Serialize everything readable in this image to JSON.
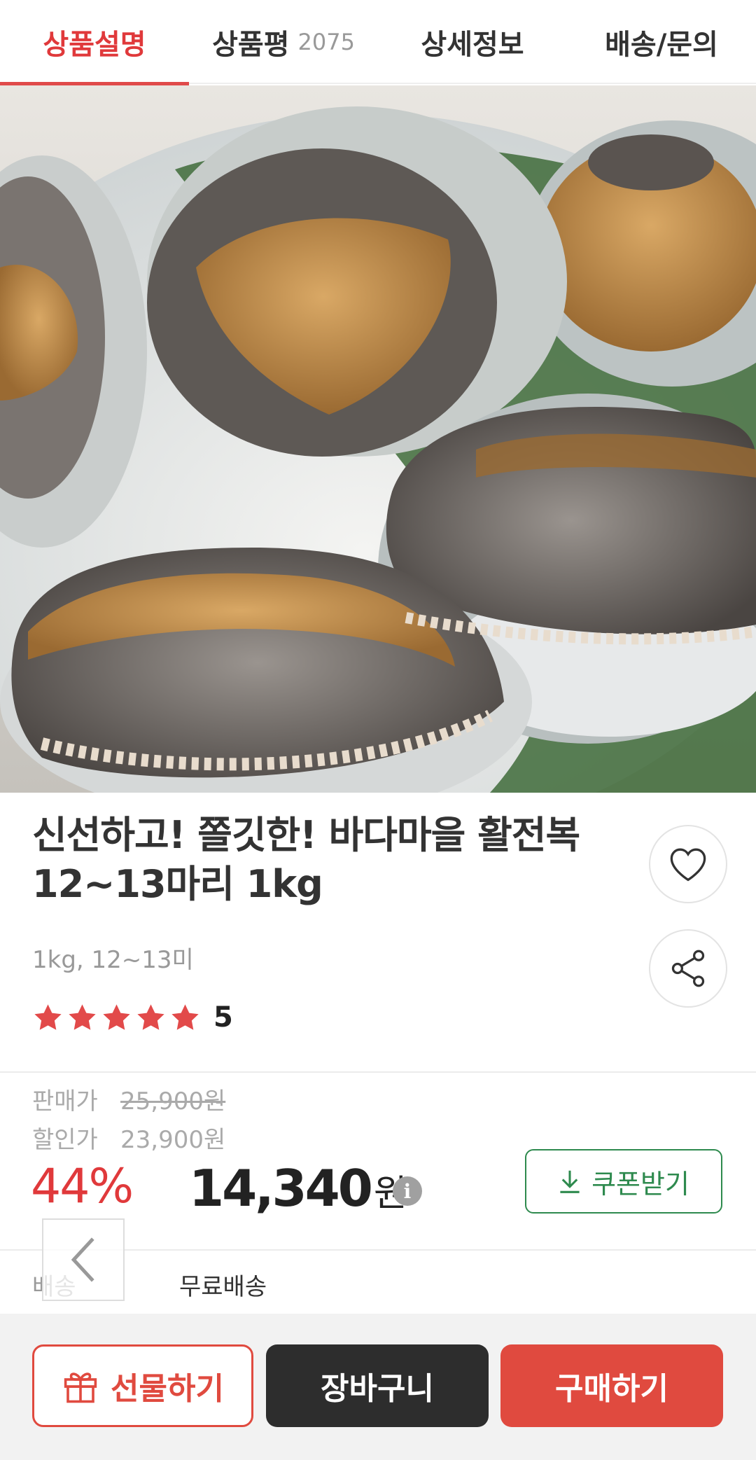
{
  "tabs": [
    {
      "label": "상품설명",
      "count": ""
    },
    {
      "label": "상품평",
      "count": "2075"
    },
    {
      "label": "상세정보",
      "count": ""
    },
    {
      "label": "배송/문의",
      "count": ""
    }
  ],
  "product": {
    "title_line1": "신선하고! 쫄깃한! 바다마을 활전복",
    "title_line2": "12~13마리 1kg",
    "subtitle": "1kg, 12~13미",
    "rating": "5",
    "rating_stars": 5
  },
  "price": {
    "sale_label": "판매가",
    "sale_price": "25,900원",
    "discount_label": "할인가",
    "discount_price": "23,900원",
    "discount_rate": "44%",
    "final_amount": "14,340",
    "final_unit": "원",
    "info_icon": "i"
  },
  "coupon": {
    "label": "쿠폰받기"
  },
  "shipping": {
    "label": "배송",
    "value": "무료배송"
  },
  "actions": {
    "gift": "선물하기",
    "cart": "장바구니",
    "buy": "구매하기"
  },
  "colors": {
    "accent": "#e0393b",
    "coupon": "#2e8a4e",
    "dark": "#2d2d2d"
  }
}
